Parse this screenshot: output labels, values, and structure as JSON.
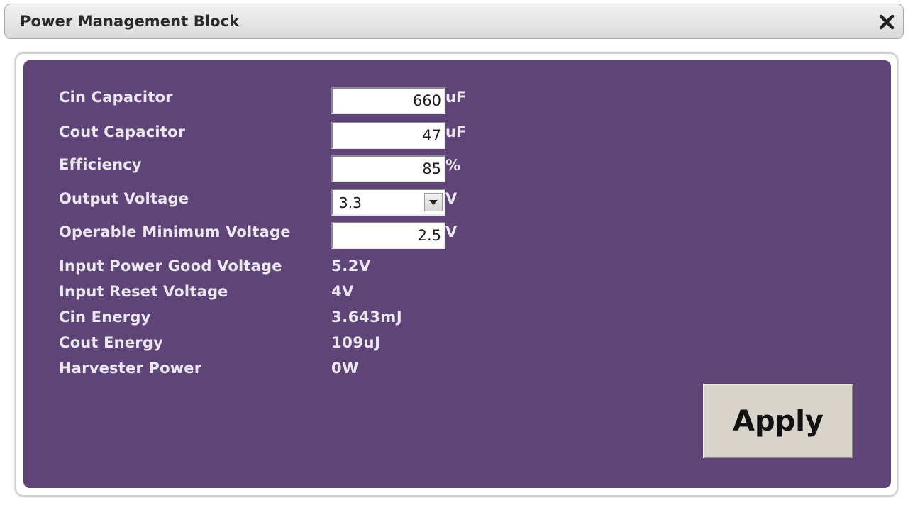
{
  "window": {
    "title": "Power Management Block",
    "close_icon": "close-icon"
  },
  "form": {
    "cin_capacitor": {
      "label": "Cin Capacitor",
      "value": "660",
      "unit": "uF"
    },
    "cout_capacitor": {
      "label": "Cout Capacitor",
      "value": "47",
      "unit": "uF"
    },
    "efficiency": {
      "label": "Efficiency",
      "value": "85",
      "unit": "%"
    },
    "output_voltage": {
      "label": "Output Voltage",
      "selected": "3.3",
      "unit": "V"
    },
    "operable_min_voltage": {
      "label": "Operable Minimum Voltage",
      "value": "2.5",
      "unit": "V"
    }
  },
  "readouts": {
    "input_power_good_voltage": {
      "label": "Input Power Good Voltage",
      "value": "5.2V"
    },
    "input_reset_voltage": {
      "label": "Input Reset Voltage",
      "value": "4V"
    },
    "cin_energy": {
      "label": "Cin Energy",
      "value": "3.643mJ"
    },
    "cout_energy": {
      "label": "Cout Energy",
      "value": "109uJ"
    },
    "harvester_power": {
      "label": "Harvester Power",
      "value": "0W"
    }
  },
  "actions": {
    "apply_label": "Apply"
  },
  "colors": {
    "panel": "#5f4477",
    "text": "#ebe7ef",
    "button": "#d8d4cc"
  }
}
